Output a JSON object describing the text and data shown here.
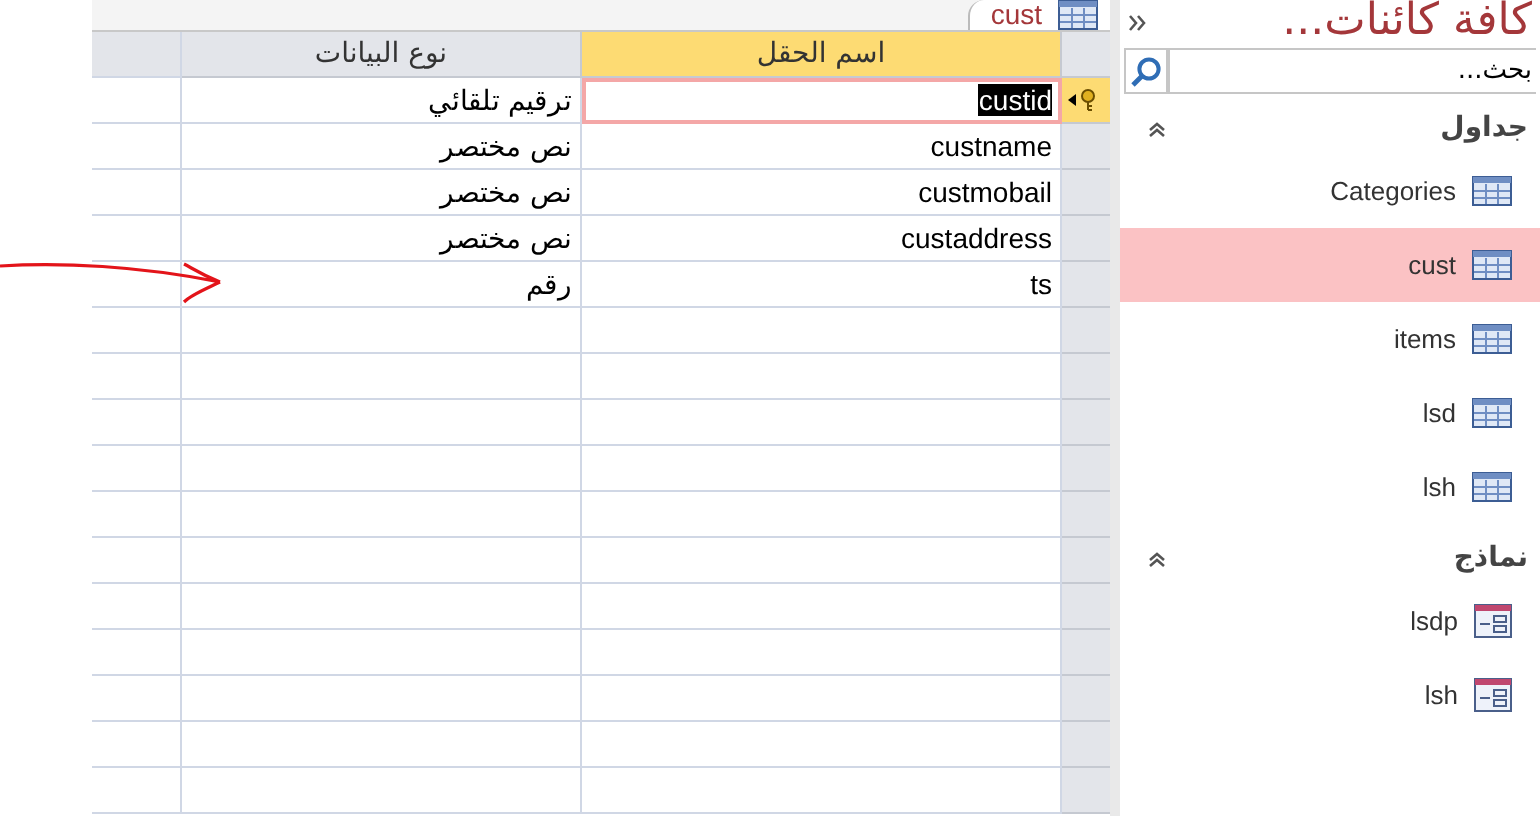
{
  "tab": {
    "label": "cust",
    "selected": true
  },
  "grid": {
    "columns": [
      "اسم الحقل",
      "نوع البيانات"
    ],
    "rows": [
      {
        "field_name": "custid",
        "data_type": "ترقيم تلقائي",
        "primary_key": true,
        "selected": true
      },
      {
        "field_name": "custname",
        "data_type": "نص مختصر",
        "primary_key": false,
        "selected": false
      },
      {
        "field_name": "custmobail",
        "data_type": "نص مختصر",
        "primary_key": false,
        "selected": false
      },
      {
        "field_name": "custaddress",
        "data_type": "نص مختصر",
        "primary_key": false,
        "selected": false
      },
      {
        "field_name": "ts",
        "data_type": "رقم",
        "primary_key": false,
        "selected": false
      }
    ]
  },
  "nav_pane": {
    "title": "كافة كائنات...",
    "search": {
      "placeholder": "بحث..."
    },
    "groups": [
      {
        "label": "جداول",
        "expanded": true,
        "items": [
          {
            "label": "Categories",
            "kind": "table",
            "selected": false
          },
          {
            "label": "cust",
            "kind": "table",
            "selected": true
          },
          {
            "label": "items",
            "kind": "table",
            "selected": false
          },
          {
            "label": "lsd",
            "kind": "table",
            "selected": false
          },
          {
            "label": "lsh",
            "kind": "table",
            "selected": false
          }
        ]
      },
      {
        "label": "نماذج",
        "expanded": true,
        "items": [
          {
            "label": "lsdp",
            "kind": "form",
            "selected": false
          },
          {
            "label": "lsh",
            "kind": "form",
            "selected": false
          }
        ]
      }
    ]
  }
}
